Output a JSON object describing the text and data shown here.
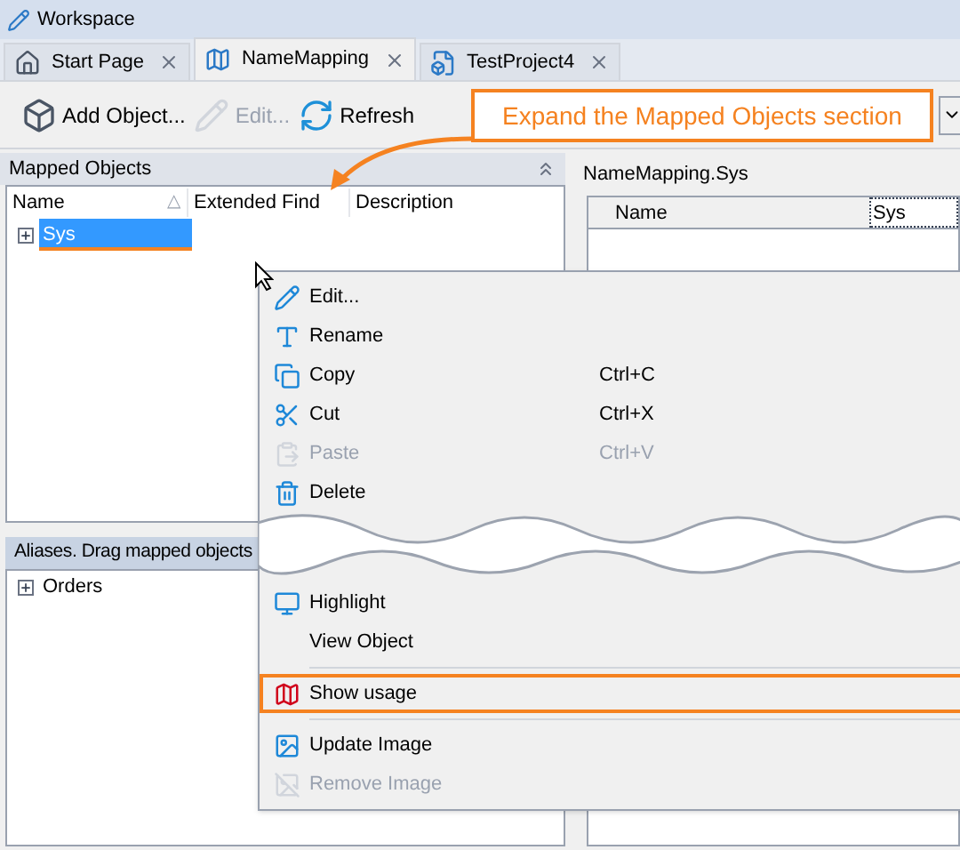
{
  "window": {
    "title": "Workspace"
  },
  "tabs": [
    {
      "label": "Start Page",
      "selected": false
    },
    {
      "label": "NameMapping",
      "selected": true
    },
    {
      "label": "TestProject4",
      "selected": false
    }
  ],
  "toolbar": {
    "buttons": [
      {
        "label": "Add Object...",
        "disabled": false
      },
      {
        "label": "Edit...",
        "disabled": true
      },
      {
        "label": "Refresh",
        "disabled": false
      }
    ]
  },
  "callout": {
    "text": "Expand the Mapped Objects section"
  },
  "mapped_objects": {
    "title": "Mapped Objects",
    "columns": [
      "Name",
      "Extended Find",
      "Description"
    ],
    "sort_indicator": "△",
    "rows": [
      {
        "name": "Sys",
        "selected": true
      }
    ]
  },
  "aliases": {
    "title": "Aliases. Drag mapped objects",
    "rows": [
      {
        "name": "Orders",
        "selected": false
      }
    ]
  },
  "detail_panel": {
    "title": "NameMapping.Sys",
    "columns": [
      "Name",
      "Sys"
    ]
  },
  "context_menu": {
    "items": [
      {
        "kind": "item",
        "label": "Edit...",
        "disabled": false,
        "highlighted": false
      },
      {
        "kind": "item",
        "label": "Rename",
        "disabled": false,
        "highlighted": false
      },
      {
        "kind": "item",
        "label": "Copy",
        "shortcut": "Ctrl+C",
        "disabled": false,
        "highlighted": false
      },
      {
        "kind": "item",
        "label": "Cut",
        "shortcut": "Ctrl+X",
        "disabled": false,
        "highlighted": false
      },
      {
        "kind": "item",
        "label": "Paste",
        "shortcut": "Ctrl+V",
        "disabled": true,
        "highlighted": false
      },
      {
        "kind": "item",
        "label": "Delete",
        "disabled": false,
        "highlighted": false
      },
      {
        "kind": "tear"
      },
      {
        "kind": "item",
        "label": "Highlight",
        "disabled": false,
        "highlighted": false
      },
      {
        "kind": "item",
        "label": "View Object",
        "disabled": false,
        "highlighted": false
      },
      {
        "kind": "separator"
      },
      {
        "kind": "item",
        "label": "Show usage",
        "disabled": false,
        "highlighted": true
      },
      {
        "kind": "separator"
      },
      {
        "kind": "item",
        "label": "Update Image",
        "disabled": false,
        "highlighted": false
      },
      {
        "kind": "item",
        "label": "Remove Image",
        "disabled": true,
        "highlighted": false
      }
    ]
  }
}
